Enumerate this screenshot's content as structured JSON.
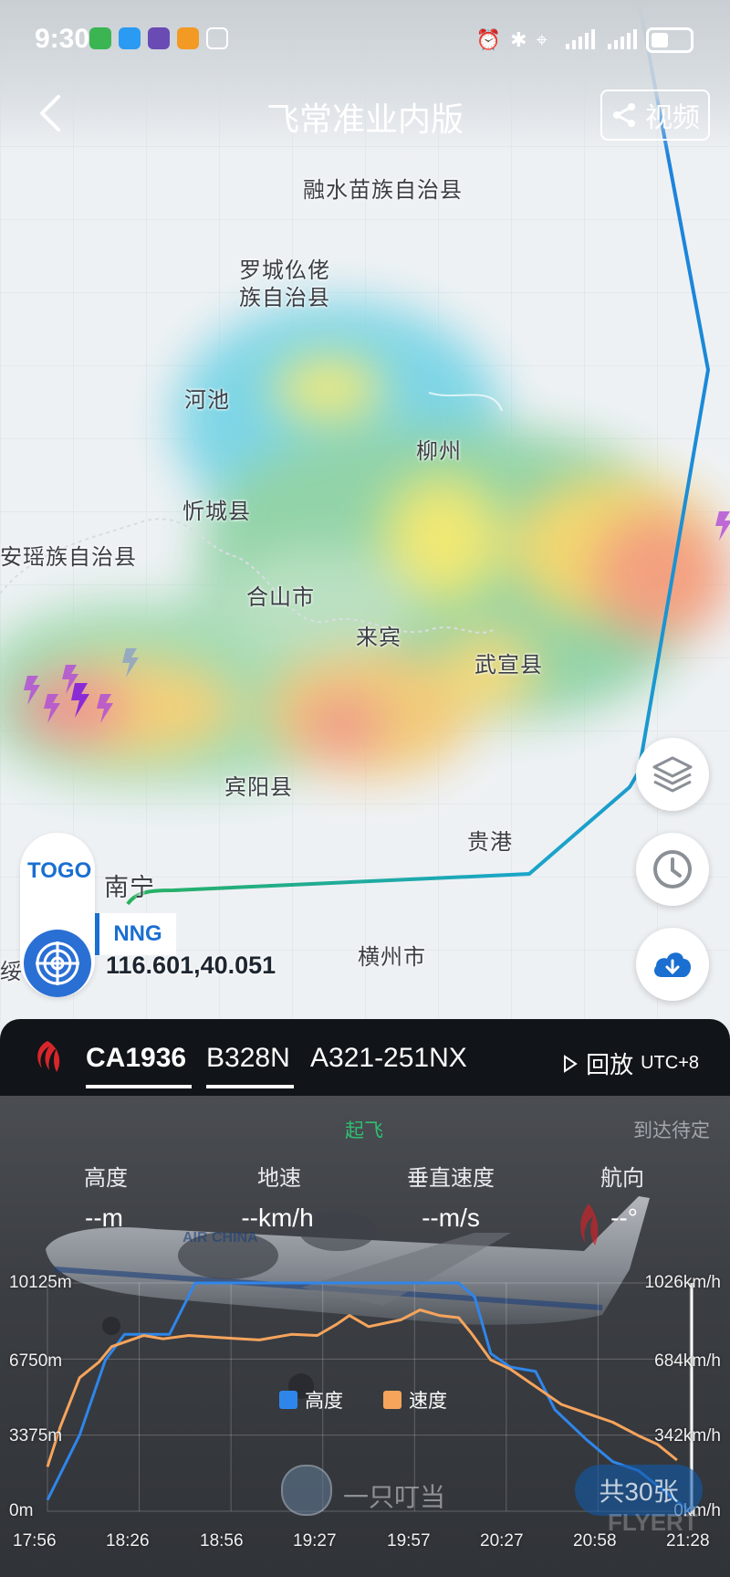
{
  "status_bar": {
    "time": "9:30"
  },
  "header": {
    "back_icon": "chevron-left-icon",
    "title": "飞常准业内版",
    "video_label": "视频",
    "share_icon": "share-icon"
  },
  "map": {
    "places": [
      "融水苗族自治县",
      "罗城仫佬",
      "族自治县",
      "河池",
      "柳州",
      "忻城县",
      "安瑶族自治县",
      "合山市",
      "来宾",
      "武宣县",
      "宾阳县",
      "贵港",
      "南宁",
      "横州市",
      "绥县"
    ],
    "togo_label": "TOGO",
    "airport_code": "NNG",
    "coordinates": "116.601,40.051",
    "buttons": {
      "layers_icon": "layers-icon",
      "history_icon": "clock-icon",
      "download_icon": "cloud-download-icon"
    }
  },
  "flight": {
    "airline_logo": "air-china-logo",
    "flight_number": "CA1936",
    "registration": "B328N",
    "aircraft_type": "A321-251NX",
    "replay_label": "回放",
    "timezone": "UTC+8"
  },
  "panel": {
    "phase_start": "起飞",
    "phase_end": "到达待定",
    "metrics": [
      {
        "label": "高度",
        "value": "--m"
      },
      {
        "label": "地速",
        "value": "--km/h"
      },
      {
        "label": "垂直速度",
        "value": "--m/s"
      },
      {
        "label": "航向",
        "value": "--°"
      }
    ],
    "photo_author": "一只叮当",
    "photo_count": "共30张",
    "watermark": "FLYERT"
  },
  "chart_data": {
    "type": "line",
    "x_ticks": [
      "17:56",
      "18:26",
      "18:56",
      "19:27",
      "19:57",
      "20:27",
      "20:58",
      "21:28"
    ],
    "left_axis": {
      "ticks": [
        "10125m",
        "6750m",
        "3375m",
        "0m"
      ],
      "ylim": [
        0,
        10125
      ]
    },
    "right_axis": {
      "ticks": [
        "1026km/h",
        "684km/h",
        "342km/h",
        "0km/h"
      ],
      "ylim": [
        0,
        1026
      ]
    },
    "series": [
      {
        "name": "高度",
        "color": "#2f86ea",
        "axis": "left",
        "points": [
          [
            0,
            500
          ],
          [
            0.05,
            3375
          ],
          [
            0.09,
            6700
          ],
          [
            0.12,
            7850
          ],
          [
            0.19,
            7850
          ],
          [
            0.23,
            10125
          ],
          [
            0.64,
            10125
          ],
          [
            0.665,
            9500
          ],
          [
            0.69,
            7000
          ],
          [
            0.72,
            6400
          ],
          [
            0.76,
            6200
          ],
          [
            0.79,
            4500
          ],
          [
            0.84,
            3150
          ],
          [
            0.88,
            2200
          ],
          [
            0.92,
            1800
          ],
          [
            0.96,
            900
          ],
          [
            1.0,
            0
          ]
        ]
      },
      {
        "name": "速度",
        "color": "#f6a45c",
        "axis": "right",
        "points": [
          [
            0,
            200
          ],
          [
            0.02,
            380
          ],
          [
            0.05,
            600
          ],
          [
            0.08,
            670
          ],
          [
            0.1,
            740
          ],
          [
            0.12,
            760
          ],
          [
            0.15,
            790
          ],
          [
            0.18,
            775
          ],
          [
            0.22,
            790
          ],
          [
            0.27,
            780
          ],
          [
            0.33,
            770
          ],
          [
            0.38,
            795
          ],
          [
            0.42,
            790
          ],
          [
            0.45,
            840
          ],
          [
            0.47,
            880
          ],
          [
            0.5,
            830
          ],
          [
            0.55,
            860
          ],
          [
            0.58,
            905
          ],
          [
            0.61,
            880
          ],
          [
            0.64,
            870
          ],
          [
            0.66,
            800
          ],
          [
            0.69,
            680
          ],
          [
            0.72,
            640
          ],
          [
            0.76,
            560
          ],
          [
            0.8,
            480
          ],
          [
            0.84,
            440
          ],
          [
            0.88,
            400
          ],
          [
            0.92,
            340
          ],
          [
            0.95,
            300
          ],
          [
            0.98,
            230
          ]
        ]
      }
    ],
    "legend_position": "center",
    "colors": {
      "altitude": "#2f86ea",
      "speed": "#f6a45c"
    }
  }
}
